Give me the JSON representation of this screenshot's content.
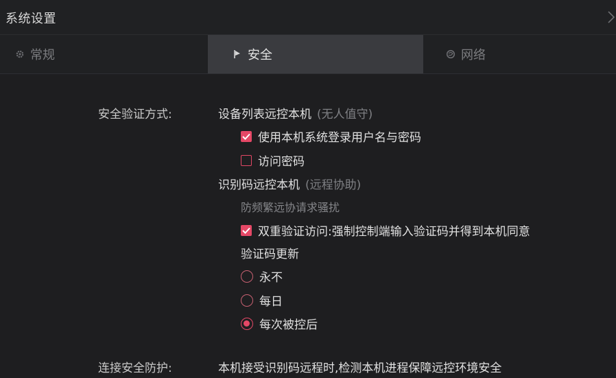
{
  "window": {
    "title": "系统设置",
    "close_icon": "chevron-right-icon"
  },
  "tabs": [
    {
      "label": "常规",
      "icon": "gear-icon",
      "active": false
    },
    {
      "label": "安全",
      "icon": "flag-icon",
      "active": true
    },
    {
      "label": "网络",
      "icon": "globe-icon",
      "active": false
    }
  ],
  "security": {
    "auth_label": "安全验证方式:",
    "device_list_title": "设备列表远控本机",
    "device_list_note": "(无人值守)",
    "use_system_login": {
      "label": "使用本机系统登录用户名与密码",
      "checked": true
    },
    "access_password": {
      "label": "访问密码",
      "checked": false
    },
    "id_code_title": "识别码远控本机",
    "id_code_note": "(远程协助)",
    "anti_harass_label": "防频繁远协请求骚扰",
    "dual_verify": {
      "label": "双重验证访问:强制控制端输入验证码并得到本机同意",
      "checked": true
    },
    "code_refresh_label": "验证码更新",
    "refresh_options": [
      {
        "label": "永不",
        "selected": false
      },
      {
        "label": "每日",
        "selected": false
      },
      {
        "label": "每次被控后",
        "selected": true
      }
    ],
    "connection_label": "连接安全防护:",
    "connection_desc": "本机接受识别码远程时,检测本机进程保障远控环境安全"
  },
  "colors": {
    "accent": "#e54866",
    "background": "#1e1e20",
    "active_tab": "#3a3b3f"
  }
}
